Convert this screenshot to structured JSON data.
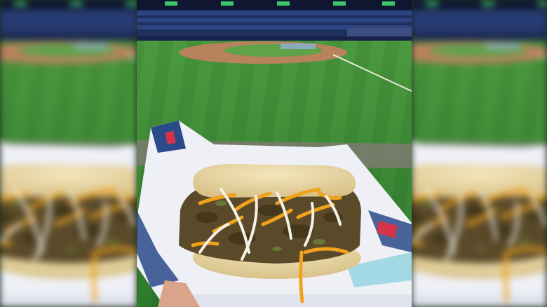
{
  "image": {
    "type": "photo",
    "layout": "vertical-photo-centered-with-blurred-side-fill",
    "colors": {
      "grass": "#3f8a35",
      "grass_dark": "#2f6f2a",
      "infield_dirt": "#b8825c",
      "stands": "#273a6a",
      "bun": "#e8d7a8",
      "cheese_orange": "#f0a21c",
      "cheese_white": "#f4f1e6",
      "shredded_meat": "#5a4a2a",
      "wrapper": "#eef0f6",
      "wrapper_accent": "#2a4a8a",
      "wrapper_red": "#d4334a"
    }
  }
}
